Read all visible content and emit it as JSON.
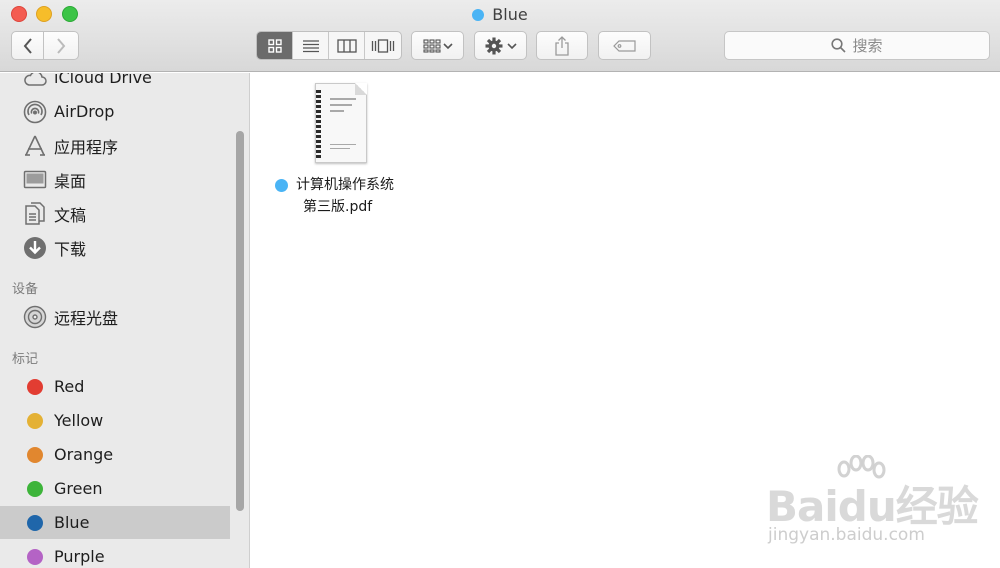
{
  "window": {
    "title": "Blue",
    "title_tag_color": "#4ab4f5"
  },
  "toolbar": {
    "back_icon": "chevron-left-icon",
    "forward_icon": "chevron-right-icon",
    "view_modes": [
      {
        "icon": "icon-view-icon",
        "active": true
      },
      {
        "icon": "list-view-icon",
        "active": false
      },
      {
        "icon": "column-view-icon",
        "active": false
      },
      {
        "icon": "cover-flow-icon",
        "active": false
      }
    ],
    "arrange_icon": "arrange-grid-icon",
    "action_icon": "gear-icon",
    "share_icon": "share-icon",
    "tag_icon": "tag-icon",
    "search_placeholder": "搜索"
  },
  "sidebar": {
    "favorites": [
      {
        "label": "iCloud Drive",
        "icon": "cloud-icon"
      },
      {
        "label": "AirDrop",
        "icon": "airdrop-icon"
      },
      {
        "label": "应用程序",
        "icon": "applications-icon"
      },
      {
        "label": "桌面",
        "icon": "desktop-icon"
      },
      {
        "label": "文稿",
        "icon": "documents-icon"
      },
      {
        "label": "下载",
        "icon": "download-icon"
      }
    ],
    "devices_header": "设备",
    "devices": [
      {
        "label": "远程光盘",
        "icon": "disc-icon"
      }
    ],
    "tags_header": "标记",
    "tags": [
      {
        "label": "Red",
        "color": "#e23d32",
        "selected": false
      },
      {
        "label": "Yellow",
        "color": "#e4b134",
        "selected": false
      },
      {
        "label": "Orange",
        "color": "#e1872f",
        "selected": false
      },
      {
        "label": "Green",
        "color": "#3db43a",
        "selected": false
      },
      {
        "label": "Blue",
        "color": "#1f66aa",
        "selected": true
      },
      {
        "label": "Purple",
        "color": "#b463c5",
        "selected": false
      }
    ]
  },
  "main": {
    "files": [
      {
        "name_line1": "计算机操作系统",
        "name_line2": "第三版.pdf",
        "tag_color": "#4ab4f5",
        "icon": "pdf-document-icon"
      }
    ]
  },
  "watermark": {
    "brand": "Baidu经验",
    "url": "jingyan.baidu.com"
  }
}
